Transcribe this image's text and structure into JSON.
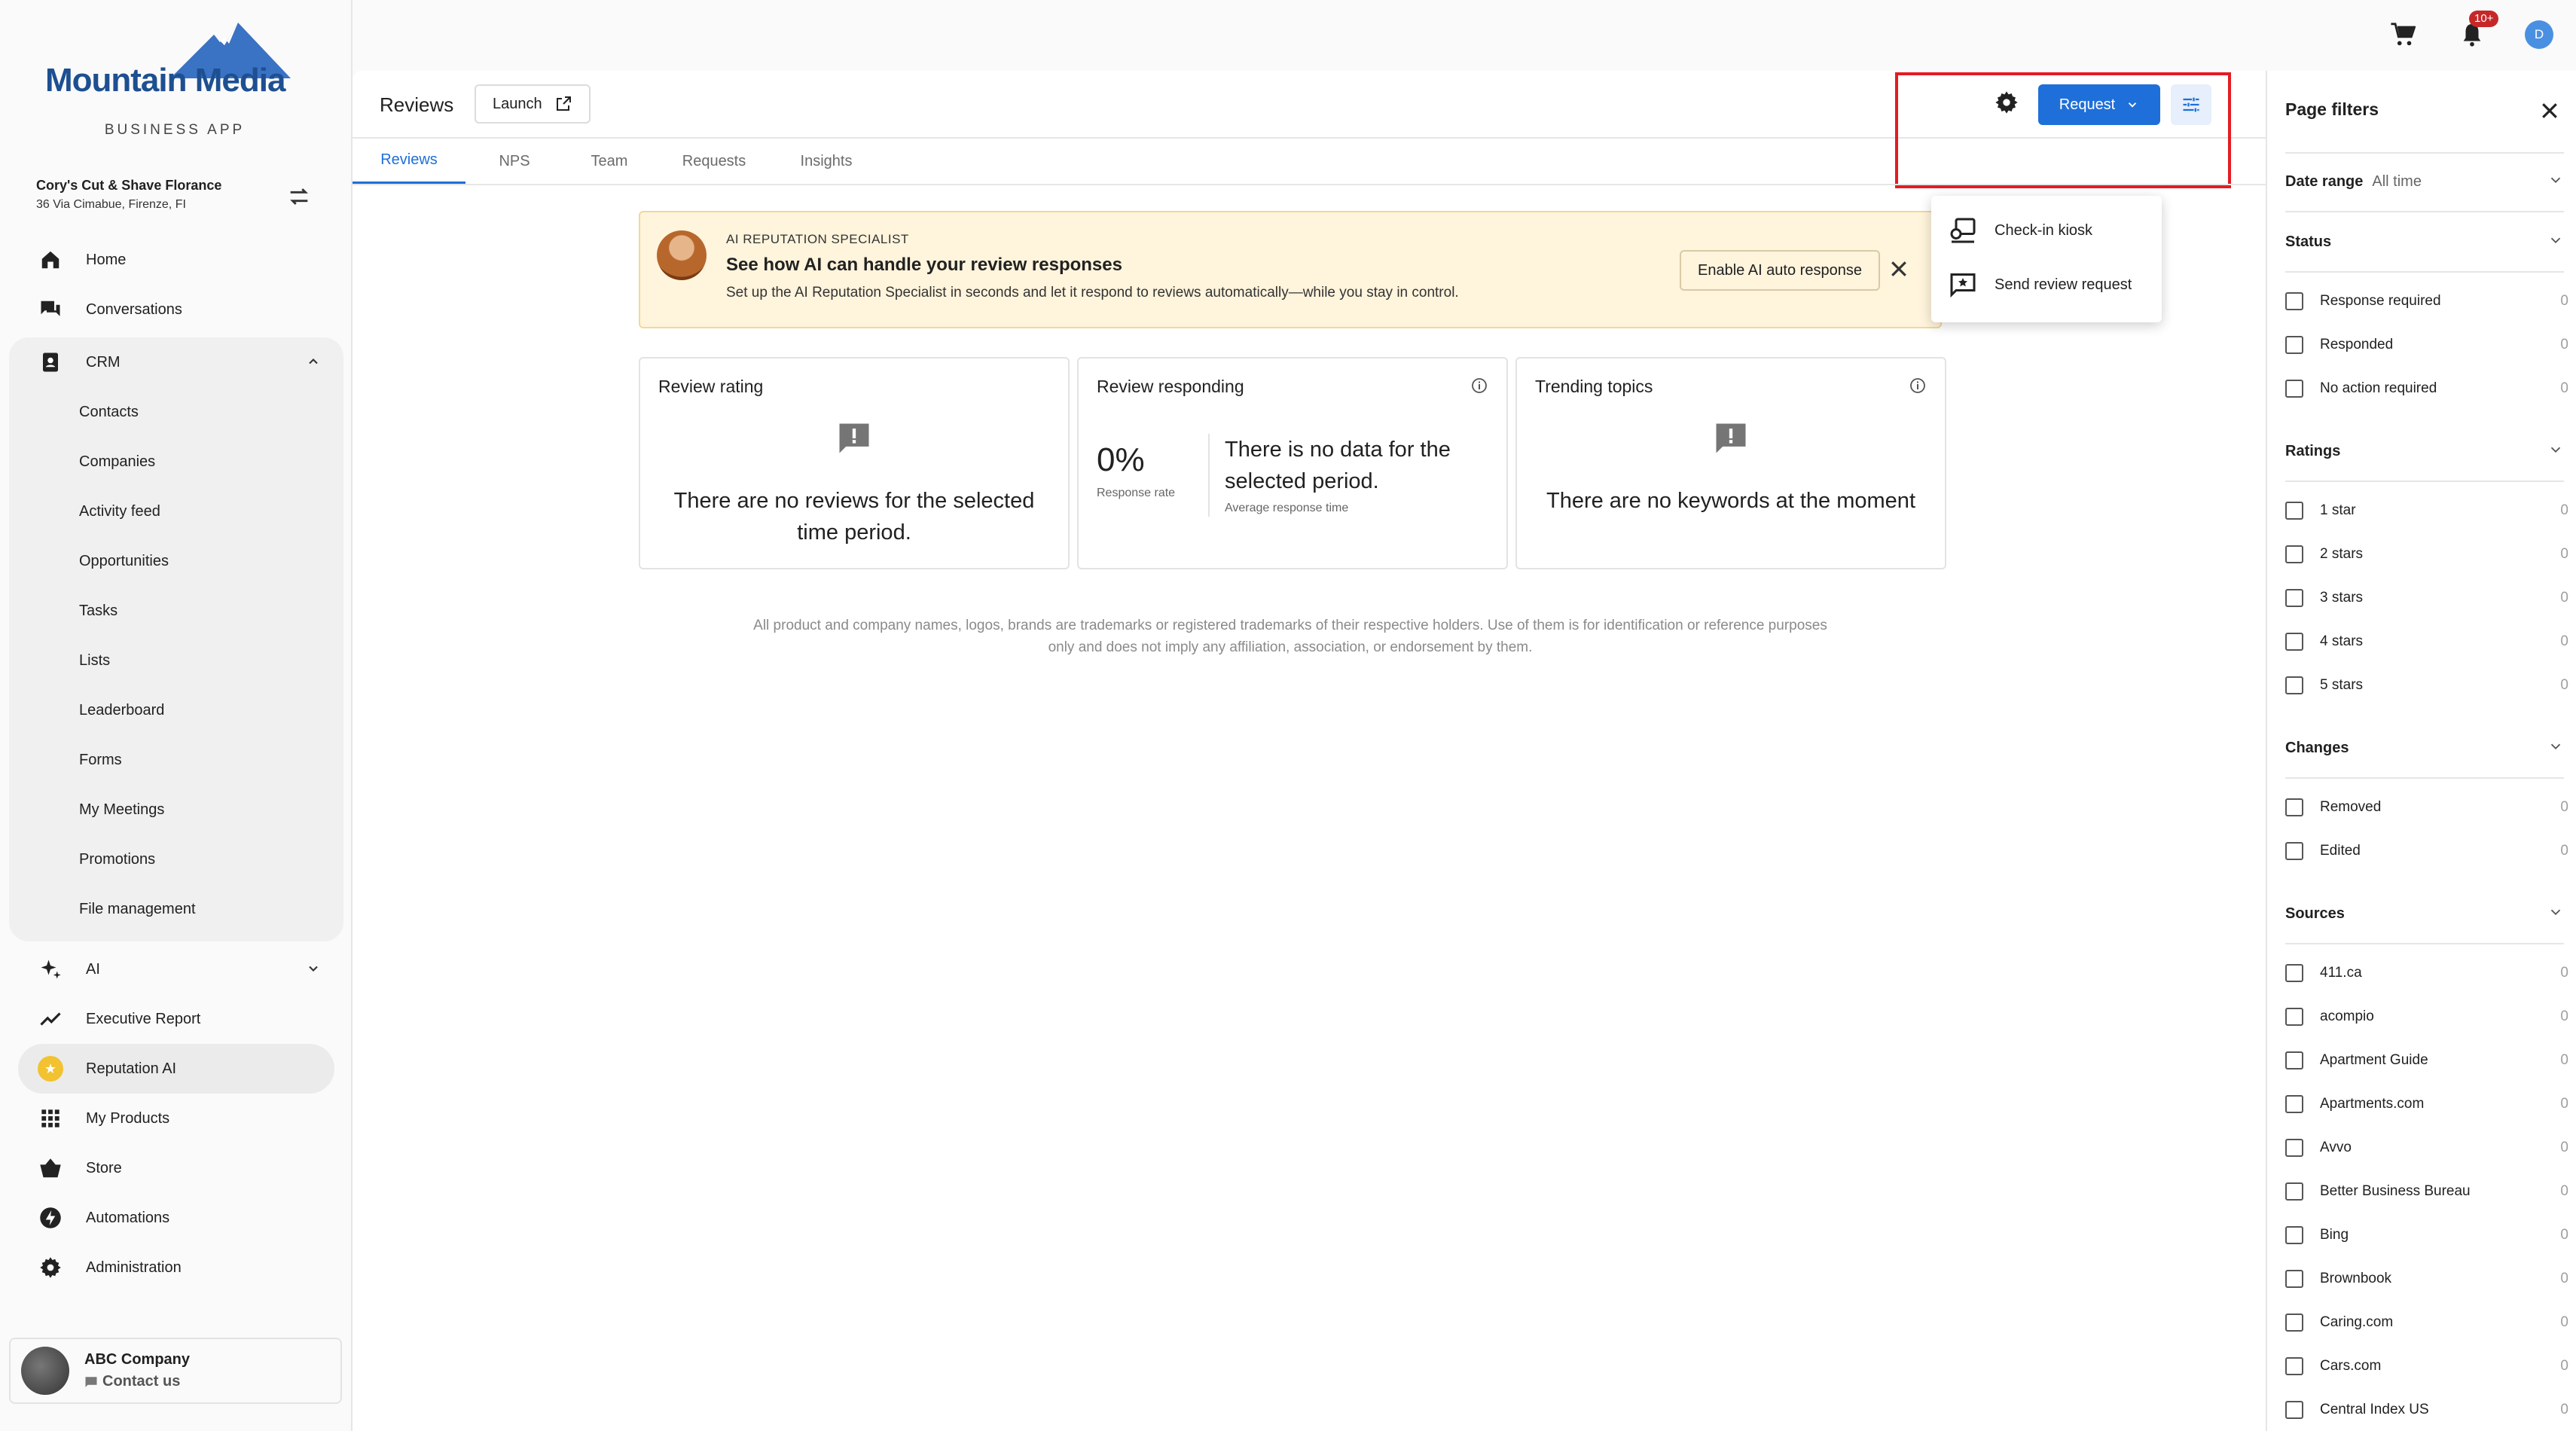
{
  "brand": {
    "name": "Mountain Media",
    "subtitle": "BUSINESS APP",
    "color": "#1d4f91"
  },
  "business": {
    "name": "Cory's Cut & Shave Florance",
    "address": "36 Via Cimabue, Firenze, FI"
  },
  "topbar": {
    "notification_badge": "10+",
    "user_initial": "D"
  },
  "nav": {
    "home": "Home",
    "conversations": "Conversations",
    "crm": "CRM",
    "crm_items": [
      "Contacts",
      "Companies",
      "Activity feed",
      "Opportunities",
      "Tasks",
      "Lists",
      "Leaderboard",
      "Forms",
      "My Meetings",
      "Promotions",
      "File management"
    ],
    "ai": "AI",
    "executive_report": "Executive Report",
    "reputation_ai": "Reputation AI",
    "my_products": "My Products",
    "store": "Store",
    "automations": "Automations",
    "administration": "Administration"
  },
  "company": {
    "name": "ABC Company",
    "contact": "Contact us"
  },
  "header": {
    "title": "Reviews",
    "launch_label": "Launch",
    "request_label": "Request"
  },
  "tabs": [
    "Reviews",
    "NPS",
    "Team",
    "Requests",
    "Insights"
  ],
  "dropdown": {
    "items": [
      "Check-in kiosk",
      "Send review request"
    ]
  },
  "ai_banner": {
    "label": "AI REPUTATION SPECIALIST",
    "title": "See how AI can handle your review responses",
    "description": "Set up the AI Reputation Specialist in seconds and let it respond to reviews automatically—while you stay in control.",
    "button": "Enable AI auto response"
  },
  "cards": {
    "rating": {
      "title": "Review rating",
      "empty": "There are no reviews for the selected time period."
    },
    "responding": {
      "title": "Review responding",
      "rate": "0%",
      "rate_label": "Response rate",
      "empty": "There is no data for the selected period.",
      "sub": "Average response time"
    },
    "topics": {
      "title": "Trending topics",
      "empty": "There are no keywords at the moment"
    }
  },
  "disclaimer_line1": "All product and company names, logos, brands are trademarks or registered trademarks of their respective holders. Use of them is for identification or reference purposes",
  "disclaimer_line2": "only and does not imply any affiliation, association, or endorsement by them.",
  "filters": {
    "title": "Page filters",
    "date_range_label": "Date range",
    "date_range_value": "All time",
    "status_label": "Status",
    "status": [
      {
        "label": "Response required",
        "count": "0"
      },
      {
        "label": "Responded",
        "count": "0"
      },
      {
        "label": "No action required",
        "count": "0"
      }
    ],
    "ratings_label": "Ratings",
    "ratings": [
      {
        "label": "1 star",
        "count": "0"
      },
      {
        "label": "2 stars",
        "count": "0"
      },
      {
        "label": "3 stars",
        "count": "0"
      },
      {
        "label": "4 stars",
        "count": "0"
      },
      {
        "label": "5 stars",
        "count": "0"
      }
    ],
    "changes_label": "Changes",
    "changes": [
      {
        "label": "Removed",
        "count": "0"
      },
      {
        "label": "Edited",
        "count": "0"
      }
    ],
    "sources_label": "Sources",
    "sources": [
      {
        "label": "411.ca",
        "count": "0"
      },
      {
        "label": "acompio",
        "count": "0"
      },
      {
        "label": "Apartment Guide",
        "count": "0"
      },
      {
        "label": "Apartments.com",
        "count": "0"
      },
      {
        "label": "Avvo",
        "count": "0"
      },
      {
        "label": "Better Business Bureau",
        "count": "0"
      },
      {
        "label": "Bing",
        "count": "0"
      },
      {
        "label": "Brownbook",
        "count": "0"
      },
      {
        "label": "Caring.com",
        "count": "0"
      },
      {
        "label": "Cars.com",
        "count": "0"
      },
      {
        "label": "Central Index US",
        "count": "0"
      }
    ]
  },
  "colors": {
    "accent": "#1e6fd9",
    "highlight": "#e41b23",
    "banner_bg": "#fff4dc",
    "badge": "#c62828"
  }
}
